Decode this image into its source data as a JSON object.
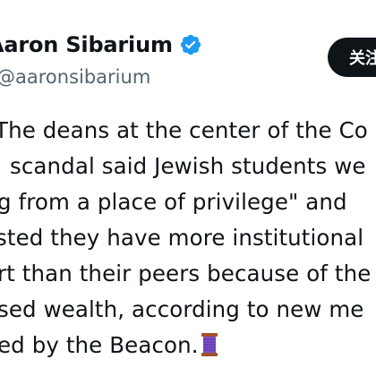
{
  "header": {
    "display_name": "Aaron Sibarium",
    "handle": "@aaronsibarium",
    "follow_label": "关注"
  },
  "icons": {
    "verified": "verified-badge-icon",
    "emoji": "spool-of-thread-emoji"
  },
  "colors": {
    "verified_blue": "#1d9bf0",
    "follow_bg": "#0f1419",
    "handle_gray": "#536471"
  },
  "tweet": {
    "lines": [
      "The deans at the center of the Co",
      "scandal said Jewish students we",
      "g from a place of privilege\" and",
      "sted they have more institutional",
      "rt than their peers because of the",
      "sed wealth, according to new me",
      "ed by the Beacon."
    ]
  }
}
